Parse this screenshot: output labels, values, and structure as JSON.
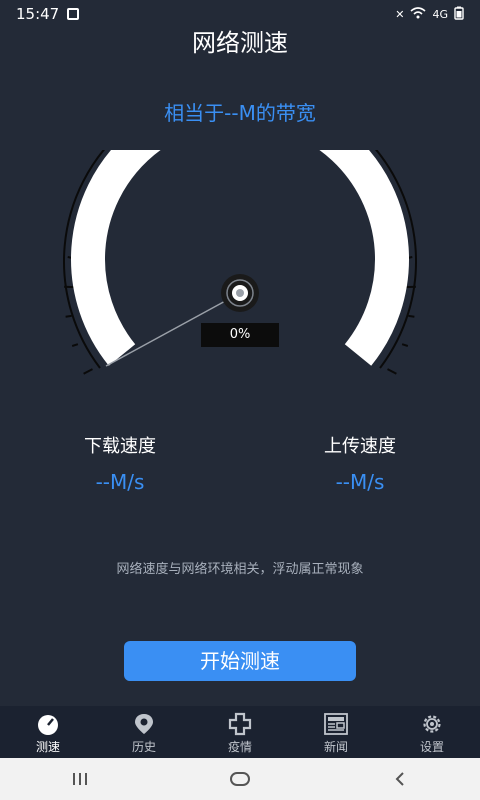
{
  "status": {
    "time": "15:47",
    "signal": "4G"
  },
  "title": "网络测速",
  "bandwidth_text": "相当于--M的带宽",
  "gauge": {
    "percent_label": "0%"
  },
  "download": {
    "label": "下载速度",
    "value": "--M/s"
  },
  "upload": {
    "label": "上传速度",
    "value": "--M/s"
  },
  "hint": "网络速度与网络环境相关，浮动属正常现象",
  "start_button": "开始测速",
  "tabs": [
    {
      "label": "测速",
      "icon": "speedometer-icon",
      "active": true
    },
    {
      "label": "历史",
      "icon": "history-icon"
    },
    {
      "label": "疫情",
      "icon": "medical-cross-icon"
    },
    {
      "label": "新闻",
      "icon": "news-icon"
    },
    {
      "label": "设置",
      "icon": "gear-icon"
    }
  ],
  "colors": {
    "accent": "#3a8ff3",
    "background": "#232a37"
  }
}
